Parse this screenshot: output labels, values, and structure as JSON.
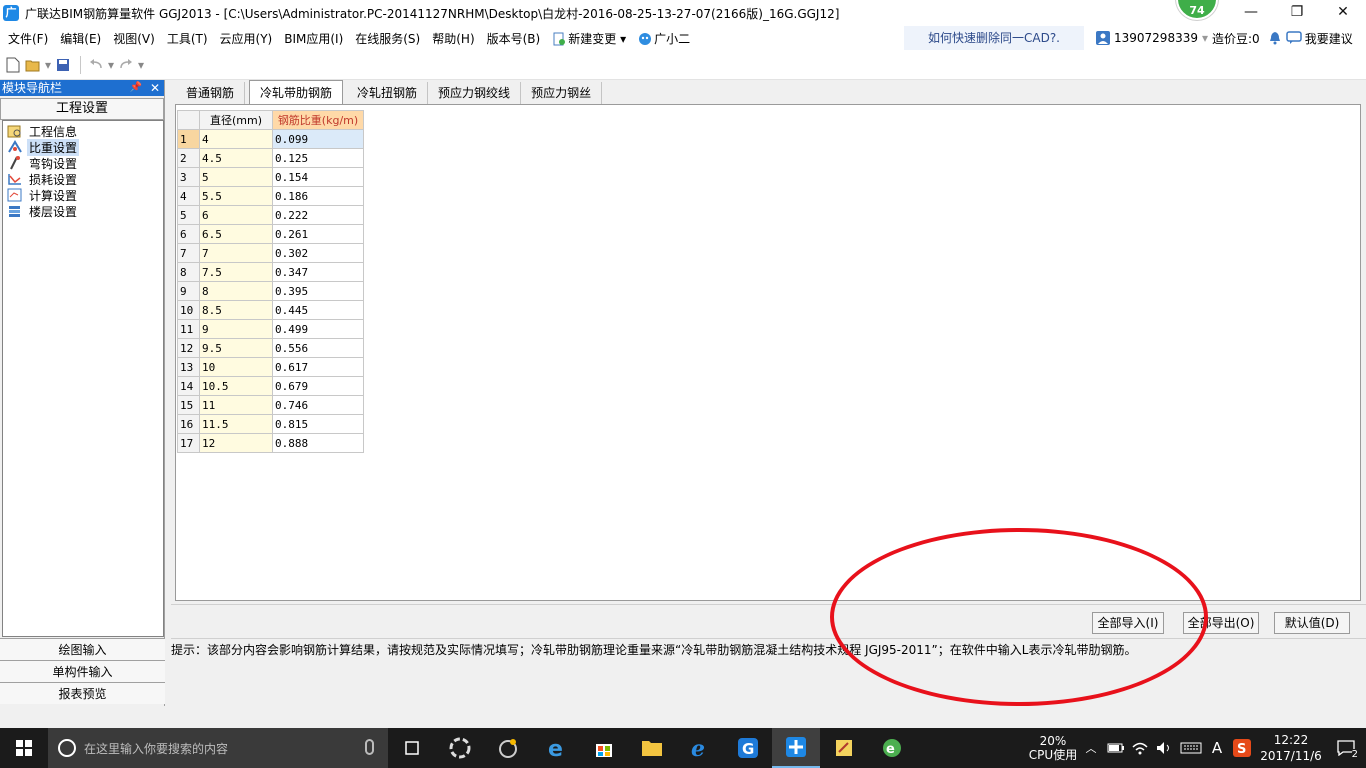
{
  "window": {
    "app_icon": "广",
    "title": "广联达BIM钢筋算量软件 GGJ2013 - [C:\\Users\\Administrator.PC-20141127NRHM\\Desktop\\白龙村-2016-08-25-13-27-07(2166版)_16G.GGJ12]",
    "badge": "74",
    "minimize": "—",
    "maximize": "❐",
    "close": "✕"
  },
  "menu": {
    "items": [
      "文件(F)",
      "编辑(E)",
      "视图(V)",
      "工具(T)",
      "云应用(Y)",
      "BIM应用(I)",
      "在线服务(S)",
      "帮助(H)",
      "版本号(B)"
    ],
    "new_change": "新建变更",
    "xiaoer": "广小二",
    "cad_tip": "如何快速删除同一CAD?.",
    "phone": "13907298339",
    "bean": "造价豆:0",
    "suggest": "我要建议"
  },
  "nav": {
    "header": "模块导航栏",
    "group": "工程设置",
    "items": [
      {
        "label": "工程信息",
        "icon": "project-info-icon"
      },
      {
        "label": "比重设置",
        "icon": "weight-setting-icon",
        "selected": true
      },
      {
        "label": "弯钩设置",
        "icon": "hook-setting-icon"
      },
      {
        "label": "损耗设置",
        "icon": "loss-setting-icon"
      },
      {
        "label": "计算设置",
        "icon": "calc-setting-icon"
      },
      {
        "label": "楼层设置",
        "icon": "floor-setting-icon"
      }
    ],
    "bottom": [
      "绘图输入",
      "单构件输入",
      "报表预览"
    ]
  },
  "tabs": [
    "普通钢筋",
    "冷轧带肋钢筋",
    "冷轧扭钢筋",
    "预应力钢绞线",
    "预应力钢丝"
  ],
  "active_tab": 1,
  "table": {
    "headers": [
      "直径(mm)",
      "钢筋比重(kg/m)"
    ],
    "rows": [
      [
        "1",
        "4",
        "0.099"
      ],
      [
        "2",
        "4.5",
        "0.125"
      ],
      [
        "3",
        "5",
        "0.154"
      ],
      [
        "4",
        "5.5",
        "0.186"
      ],
      [
        "5",
        "6",
        "0.222"
      ],
      [
        "6",
        "6.5",
        "0.261"
      ],
      [
        "7",
        "7",
        "0.302"
      ],
      [
        "8",
        "7.5",
        "0.347"
      ],
      [
        "9",
        "8",
        "0.395"
      ],
      [
        "10",
        "8.5",
        "0.445"
      ],
      [
        "11",
        "9",
        "0.499"
      ],
      [
        "12",
        "9.5",
        "0.556"
      ],
      [
        "13",
        "10",
        "0.617"
      ],
      [
        "14",
        "10.5",
        "0.679"
      ],
      [
        "15",
        "11",
        "0.746"
      ],
      [
        "16",
        "11.5",
        "0.815"
      ],
      [
        "17",
        "12",
        "0.888"
      ]
    ]
  },
  "buttons": {
    "import_all": "全部导入(I)",
    "export_all": "全部导出(O)",
    "default": "默认值(D)"
  },
  "hint": "提示：该部分内容会影响钢筋计算结果，请按规范及实际情况填写；冷轧带肋钢筋理论重量来源“冷轧带肋钢筋混凝土结构技术规程 JGJ95-2011”；在软件中输入L表示冷轧带肋钢筋。",
  "taskbar": {
    "search_placeholder": "在这里输入你要搜索的内容",
    "cpu_percent": "20%",
    "cpu_label": "CPU使用",
    "ime": "A",
    "time": "12:22",
    "date": "2017/11/6",
    "notifications": "2"
  },
  "colors": {
    "accent": "#1e6fd0",
    "annotation": "#e8111b",
    "badge": "#3fae49"
  }
}
